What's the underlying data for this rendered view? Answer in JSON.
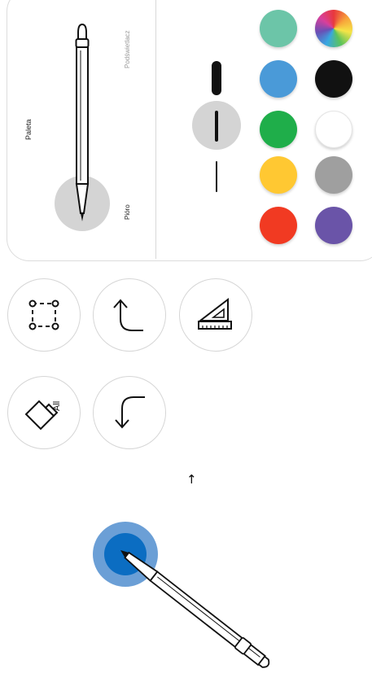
{
  "palette": {
    "label": "Paleta",
    "highlighter_label": "Podświetlacz",
    "pen_label": "Pióro",
    "selected_tool": "pen",
    "thickness_options": [
      "thick",
      "medium",
      "thin"
    ],
    "selected_thickness": "medium",
    "colors": [
      {
        "name": "teal",
        "hex": "#6cc5a8"
      },
      {
        "name": "multicolor",
        "hex": "rainbow"
      },
      {
        "name": "blue",
        "hex": "#4a9ad8"
      },
      {
        "name": "black",
        "hex": "#111111"
      },
      {
        "name": "green",
        "hex": "#1fae4a"
      },
      {
        "name": "white",
        "hex": "#ffffff"
      },
      {
        "name": "yellow",
        "hex": "#ffc832"
      },
      {
        "name": "gray",
        "hex": "#9f9f9f"
      },
      {
        "name": "red",
        "hex": "#f13a22"
      },
      {
        "name": "purple",
        "hex": "#6a54a8"
      }
    ]
  },
  "tools": {
    "select": {
      "icon": "lasso-select-icon"
    },
    "undo": {
      "icon": "undo-arrow-icon"
    },
    "ruler": {
      "icon": "set-square-ruler-icon"
    },
    "erase_all": {
      "icon": "eraser-icon",
      "text": "All"
    },
    "redo": {
      "icon": "redo-arrow-icon"
    }
  },
  "hint": {
    "arrow": "↑"
  },
  "touch_indicator": {
    "ring_color": "#6b9fd6",
    "core_color": "#0b6dc2"
  }
}
